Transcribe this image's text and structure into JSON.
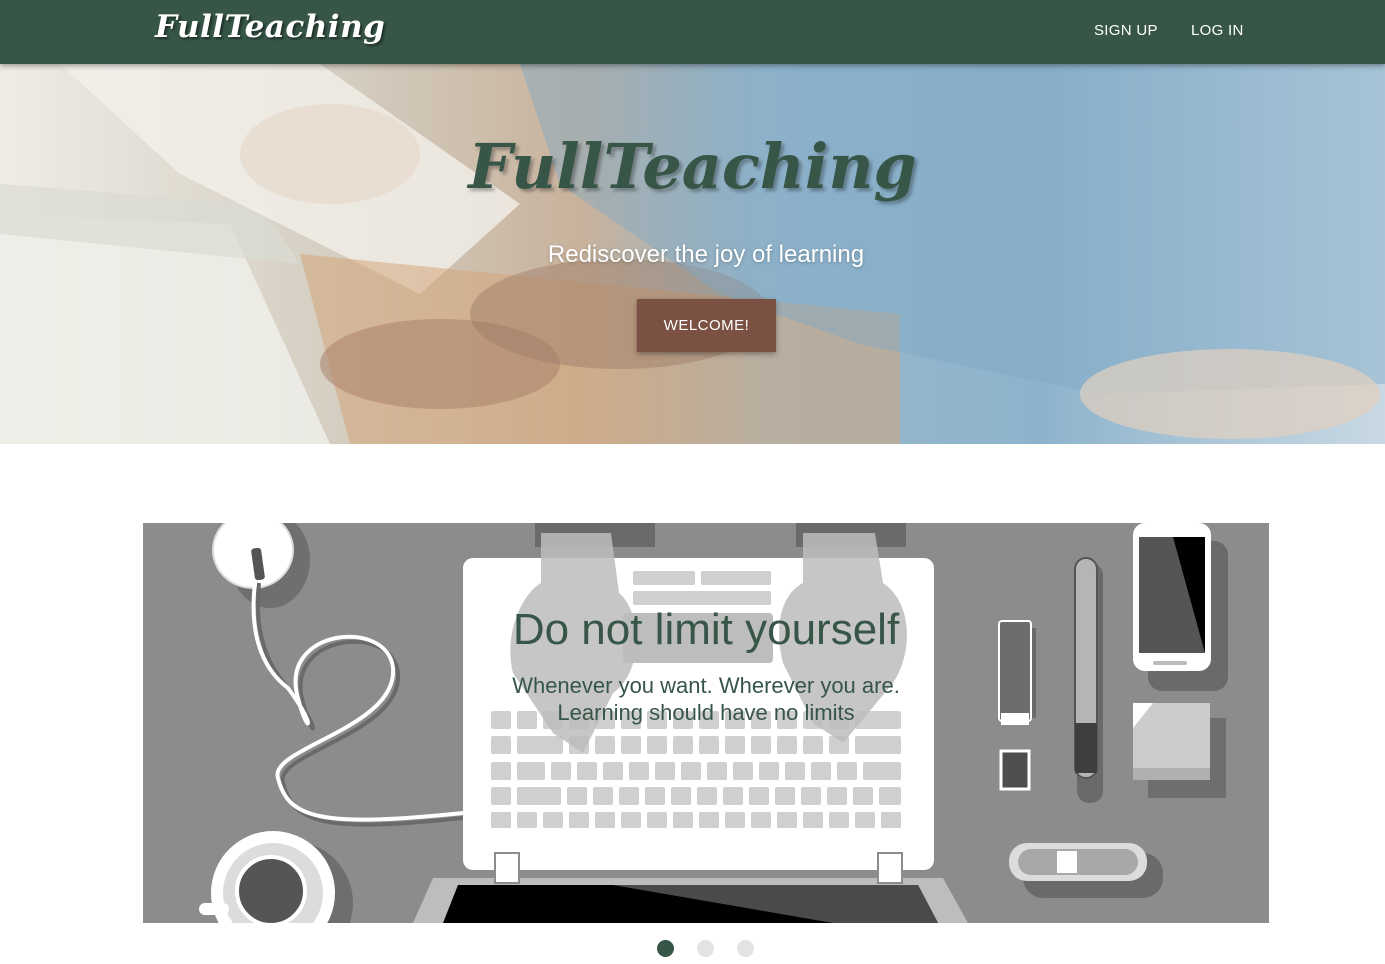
{
  "navbar": {
    "brand": "FullTeaching",
    "links": [
      {
        "label": "SIGN UP"
      },
      {
        "label": "LOG IN"
      }
    ]
  },
  "hero": {
    "title": "FullTeaching",
    "subtitle": "Rediscover the joy of learning",
    "button_label": "WELCOME!"
  },
  "carousel": {
    "slides": [
      {
        "title": "Do not limit yourself",
        "text_line1": "Whenever you want. Wherever you are.",
        "text_line2": "Learning should have no limits"
      }
    ],
    "active_index": 0,
    "indicator_count": 3
  },
  "colors": {
    "brand_green": "#375647",
    "button_brown": "#7b5143",
    "indicator_inactive": "#e3e3e3"
  }
}
